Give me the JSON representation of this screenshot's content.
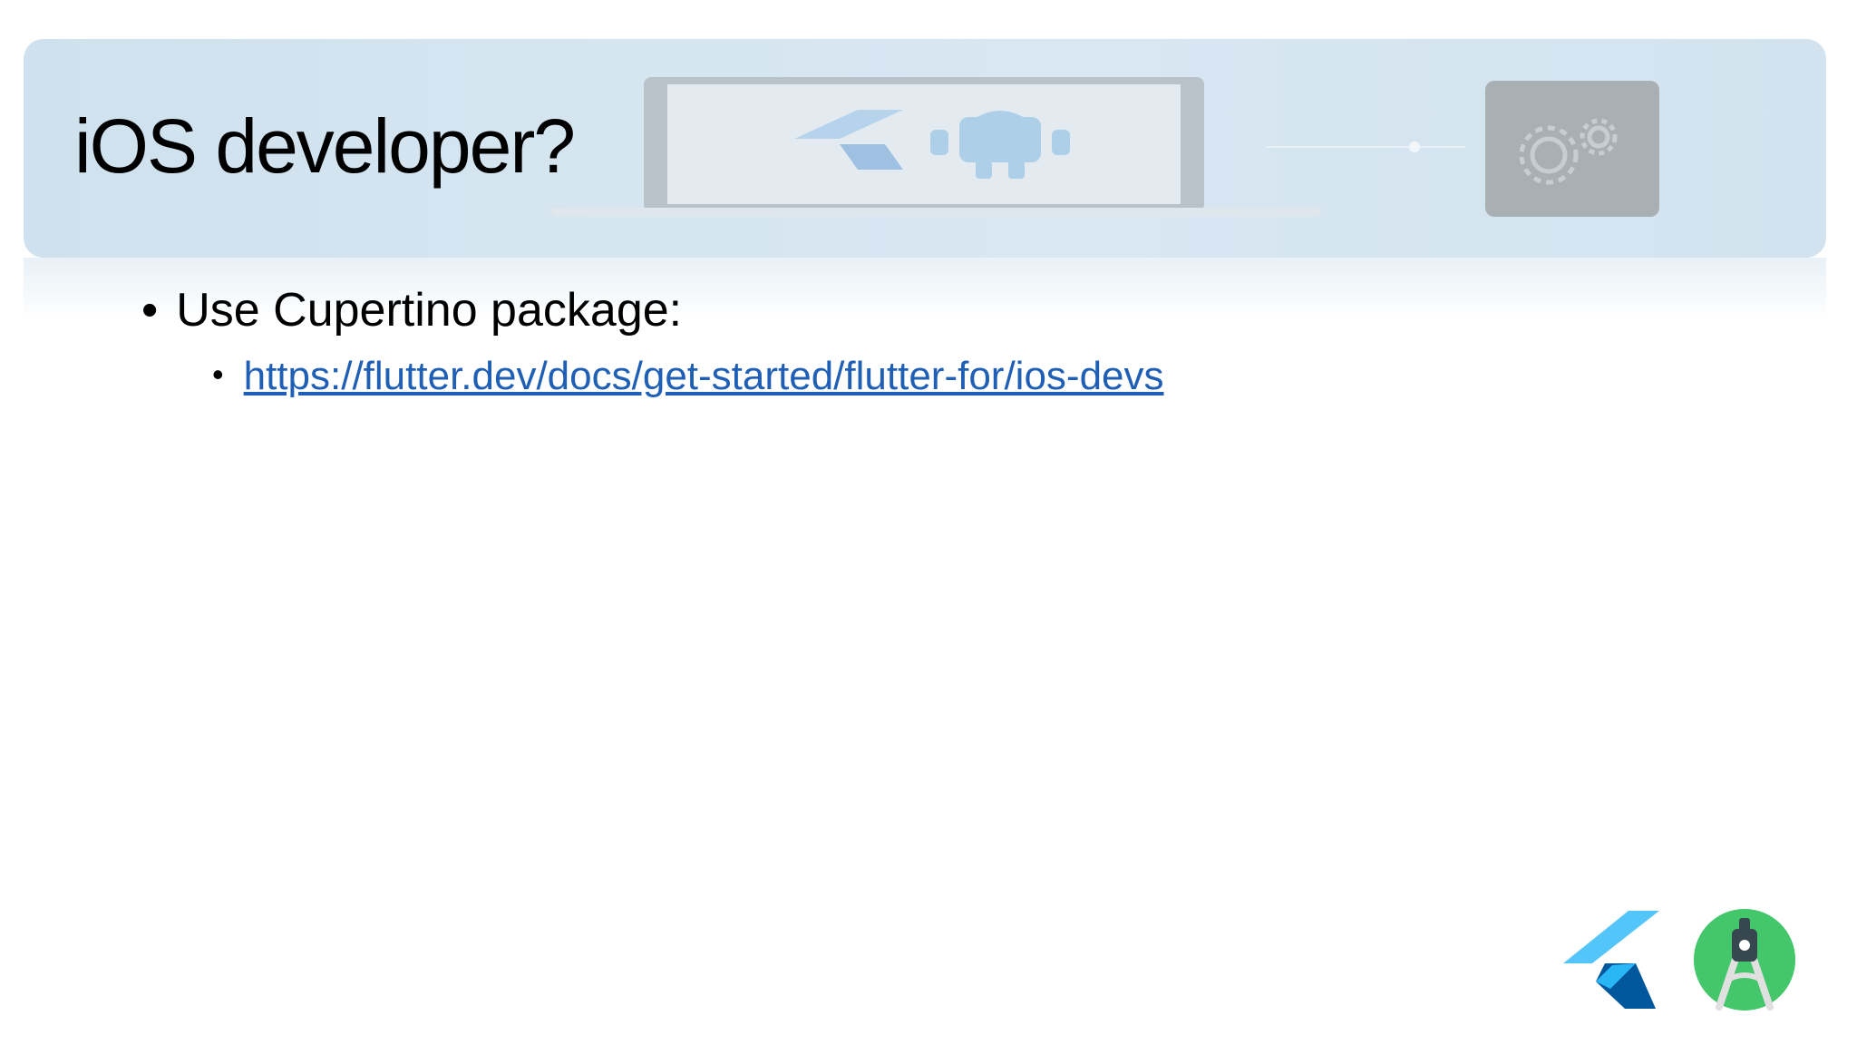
{
  "slide": {
    "title": "iOS developer?",
    "bullets": [
      {
        "text": "Use Cupertino package:",
        "sub": [
          {
            "text": "https://flutter.dev/docs/get-started/flutter-for/ios-devs",
            "is_link": true
          }
        ]
      }
    ],
    "bullet_char": "•"
  },
  "colors": {
    "banner": "#d4e5f0",
    "link": "#1f5fb5",
    "flutter_light": "#54c5f8",
    "flutter_dark": "#01579b",
    "android_studio_green": "#3ddc84"
  },
  "icons": {
    "header_decorations": [
      "laptop-illustration",
      "flutter-logo-faded",
      "android-robot-faded",
      "phone-settings-illustration"
    ],
    "footer": [
      "flutter-logo",
      "android-studio-logo"
    ]
  }
}
